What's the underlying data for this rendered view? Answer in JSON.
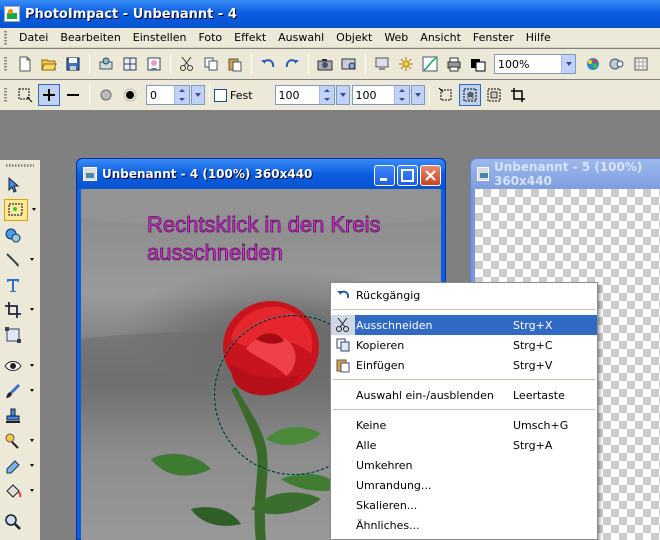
{
  "app": {
    "title": "PhotoImpact - Unbenannt - 4"
  },
  "menubar": [
    "Datei",
    "Bearbeiten",
    "Einstellen",
    "Foto",
    "Effekt",
    "Auswahl",
    "Objekt",
    "Web",
    "Ansicht",
    "Fenster",
    "Hilfe"
  ],
  "toolbar1": {
    "zoom_value": "100%"
  },
  "toolbar2": {
    "soft_edge_value": "0",
    "fixed_label": "Fest",
    "width_value": "100",
    "height_value": "100"
  },
  "doc1": {
    "title": "Unbenannt - 4 (100%) 360x440",
    "caption_line1": "Rechtsklick in den Kreis",
    "caption_line2": "ausschneiden"
  },
  "doc2": {
    "title": "Unbenannt - 5 (100%) 360x440"
  },
  "context_menu": {
    "items": [
      {
        "label": "Rückgängig",
        "shortcut": ""
      },
      {
        "label": "Ausschneiden",
        "shortcut": "Strg+X"
      },
      {
        "label": "Kopieren",
        "shortcut": "Strg+C"
      },
      {
        "label": "Einfügen",
        "shortcut": "Strg+V"
      },
      {
        "label": "Auswahl ein-/ausblenden",
        "shortcut": "Leertaste"
      },
      {
        "label": "Keine",
        "shortcut": "Umsch+G"
      },
      {
        "label": "Alle",
        "shortcut": "Strg+A"
      },
      {
        "label": "Umkehren",
        "shortcut": ""
      },
      {
        "label": "Umrandung...",
        "shortcut": ""
      },
      {
        "label": "Skalieren...",
        "shortcut": ""
      },
      {
        "label": "Ähnliches...",
        "shortcut": ""
      }
    ]
  },
  "colors": {
    "title_blue": "#0a5ee0",
    "highlight": "#316ac5",
    "caption_magenta": "#d93ad9",
    "rose_red": "#e02030"
  }
}
